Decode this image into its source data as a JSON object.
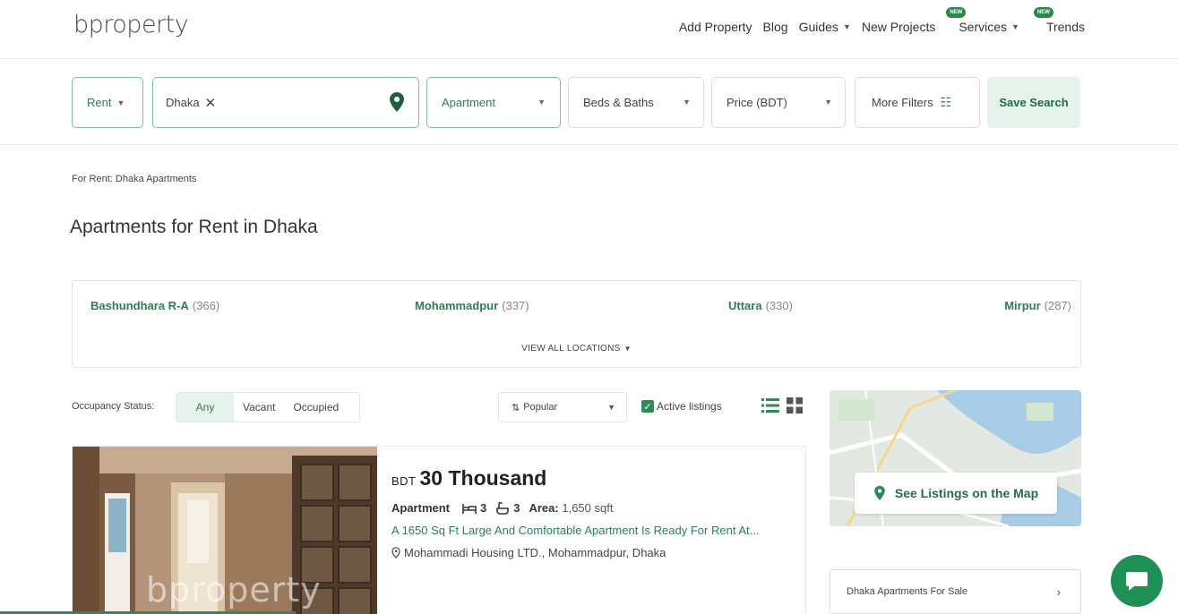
{
  "brand": {
    "logo_text": "bproperty"
  },
  "nav": {
    "items": [
      {
        "label": "Add Property"
      },
      {
        "label": "Blog"
      },
      {
        "label": "Guides",
        "has_caret": true
      },
      {
        "label": "New Projects"
      },
      {
        "label": "Services",
        "has_caret": true,
        "badge": "NEW"
      },
      {
        "label": "Trends",
        "badge": "NEW"
      }
    ]
  },
  "search": {
    "purpose": "Rent",
    "location_chip": "Dhaka",
    "property_type": "Apartment",
    "beds_baths": "Beds & Baths",
    "price": "Price (BDT)",
    "more_filters": "More Filters",
    "save_label": "Save Search"
  },
  "breadcrumb": {
    "text": "For Rent: Dhaka Apartments"
  },
  "page_title": "Apartments for Rent in Dhaka",
  "locations": {
    "items": [
      {
        "name": "Bashundhara R-A",
        "count": "(366)"
      },
      {
        "name": "Mohammadpur",
        "count": "(337)"
      },
      {
        "name": "Uttara",
        "count": "(330)"
      },
      {
        "name": "Mirpur",
        "count": "(287)"
      }
    ],
    "view_all": "VIEW ALL LOCATIONS"
  },
  "filters": {
    "occupancy_label": "Occupancy Status:",
    "occupancy_options": [
      "Any",
      "Vacant",
      "Occupied"
    ],
    "occupancy_selected": "Any",
    "sort_label": "Popular",
    "active_listings_label": "Active listings",
    "active_listings_checked": true
  },
  "listing": {
    "currency": "BDT",
    "price": "30 Thousand",
    "type": "Apartment",
    "beds": "3",
    "baths": "3",
    "area_label": "Area:",
    "area_value": "1,650 sqft",
    "description": "A 1650 Sq Ft Large And Comfortable Apartment Is Ready For Rent At...",
    "address": "Mohammadi Housing LTD., Mohammadpur, Dhaka",
    "image_watermark": "bproperty"
  },
  "sidebar": {
    "map_button": "See Listings on the Map",
    "sale_link": "Dhaka Apartments For Sale"
  },
  "colors": {
    "brand_green": "#2e7d56",
    "accent_light": "#e6f2ec",
    "fab": "#1e8f55"
  }
}
